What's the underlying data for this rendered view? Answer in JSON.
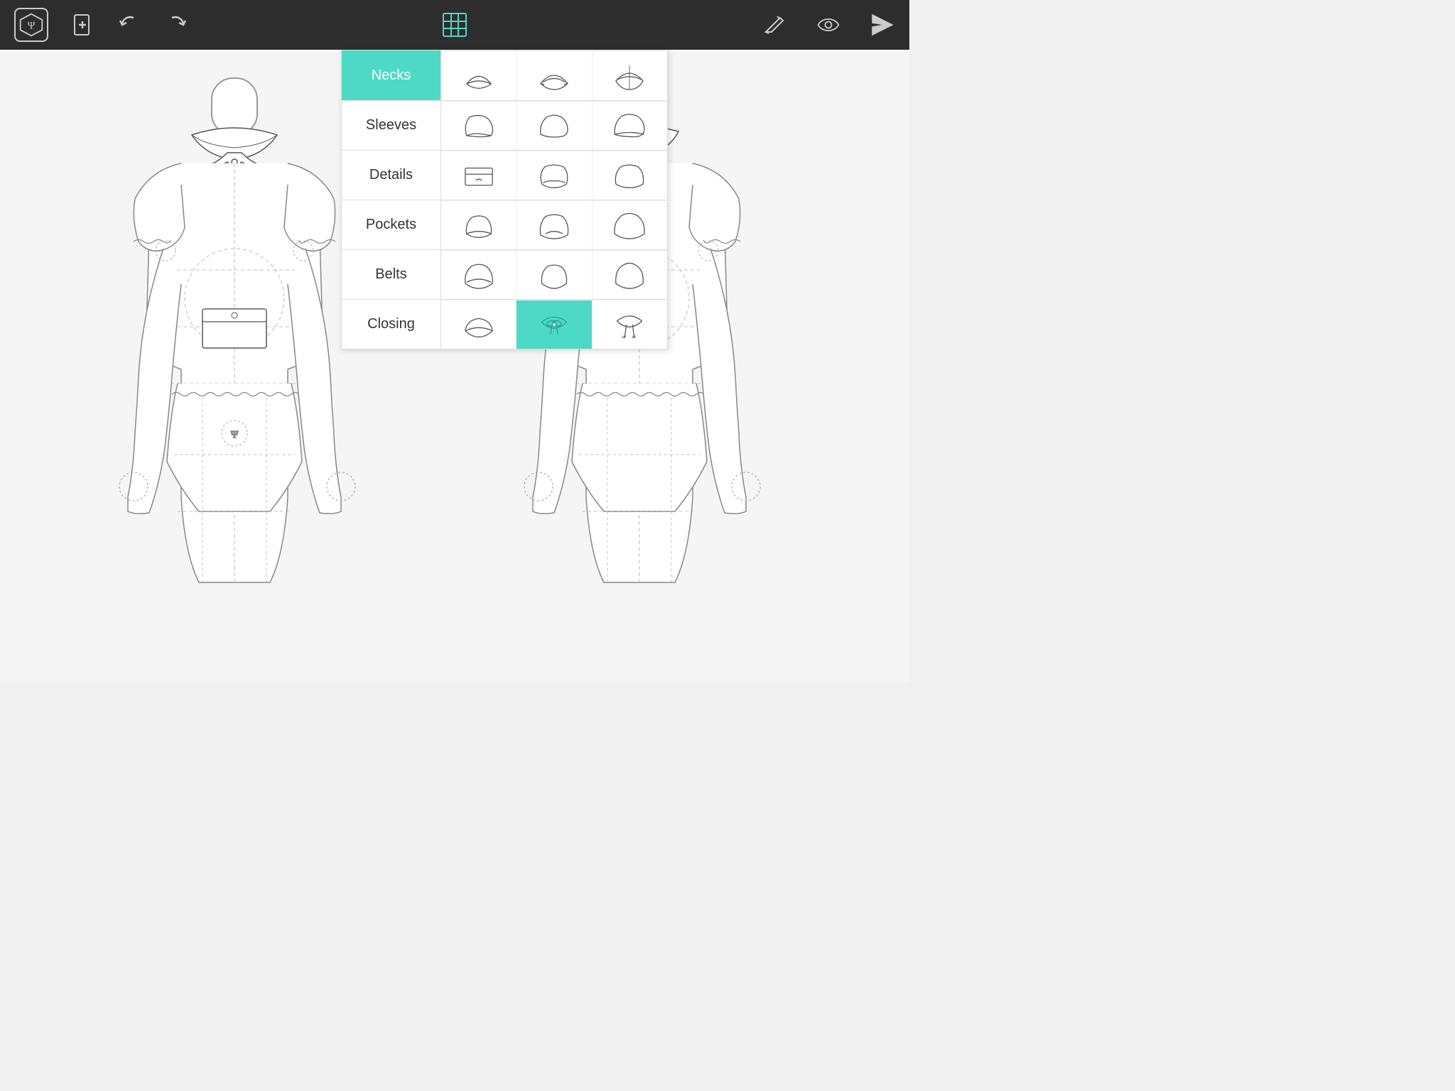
{
  "toolbar": {
    "brand_label": "Ψ",
    "new_label": "+",
    "undo_label": "↩",
    "share_label": "↪",
    "grid_icon": "grid",
    "pencil_icon": "pencil",
    "eye_icon": "eye",
    "send_icon": "send"
  },
  "dropdown": {
    "categories": [
      {
        "id": "necks",
        "label": "Necks",
        "active": true
      },
      {
        "id": "sleeves",
        "label": "Sleeves",
        "active": false
      },
      {
        "id": "details",
        "label": "Details",
        "active": false
      },
      {
        "id": "pockets",
        "label": "Pockets",
        "active": false
      },
      {
        "id": "belts",
        "label": "Belts",
        "active": false
      },
      {
        "id": "closing",
        "label": "Closing",
        "active": false
      }
    ],
    "rows": [
      {
        "category": "necks",
        "items": 3
      },
      {
        "category": "sleeves",
        "items": 3
      },
      {
        "category": "details",
        "items": 3
      },
      {
        "category": "pockets",
        "items": 3
      },
      {
        "category": "belts",
        "items": 3
      },
      {
        "category": "closing",
        "items": 3,
        "selected": 1
      }
    ]
  },
  "accent_color": "#4dd9c5",
  "toolbar_bg": "#2d2d2d"
}
